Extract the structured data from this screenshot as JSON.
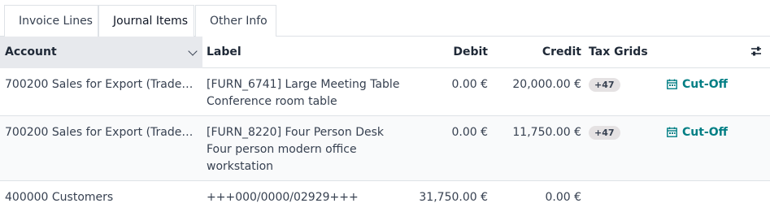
{
  "tabs": [
    {
      "label": "Invoice Lines"
    },
    {
      "label": "Journal Items",
      "active": true
    },
    {
      "label": "Other Info"
    }
  ],
  "columns": {
    "account": "Account",
    "label": "Label",
    "debit": "Debit",
    "credit": "Credit",
    "tax_grids": "Tax Grids"
  },
  "rows": [
    {
      "account": "700200 Sales for Export (Trade Go…",
      "label_lines": [
        "[FURN_6741] Large Meeting Table",
        "Conference room table"
      ],
      "debit": "0.00 €",
      "credit": "20,000.00 €",
      "tax_badge": "+47",
      "action": "Cut-Off"
    },
    {
      "account": "700200 Sales for Export (Trade Go…",
      "label_lines": [
        "[FURN_8220] Four Person Desk",
        "Four person modern office",
        "workstation"
      ],
      "debit": "0.00 €",
      "credit": "11,750.00 €",
      "tax_badge": "+47",
      "action": "Cut-Off"
    },
    {
      "account": "400000 Customers",
      "label_lines": [
        "+++000/0000/02929+++"
      ],
      "debit": "31,750.00 €",
      "credit": "0.00 €"
    }
  ],
  "colors": {
    "accent": "#017e84",
    "header_sort_bg": "#e7e9ed",
    "badge_bg": "#e5e2e3"
  }
}
